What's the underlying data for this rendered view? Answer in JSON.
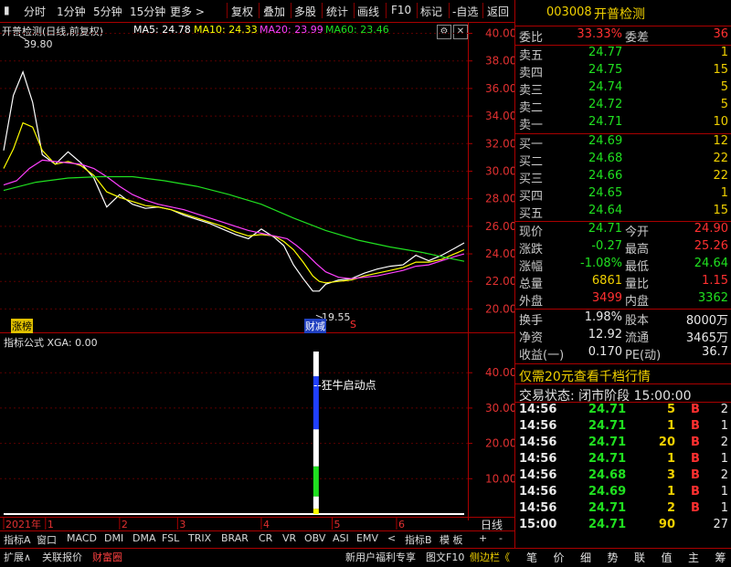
{
  "toolbar": {
    "left_tabs": [
      "分时",
      "1分钟",
      "5分钟",
      "15分钟",
      "更多 >"
    ],
    "right_tabs": [
      "复权",
      "叠加",
      "多股",
      "统计",
      "画线",
      "F10",
      "标记",
      "-自选",
      "返回"
    ]
  },
  "chart_header": {
    "title": "开普检测(日线,前复权)",
    "ma5": "MA5: 24.78",
    "ma10": "MA10: 24.33",
    "ma20": "MA20: 23.99",
    "ma60": "MA60: 23.46",
    "high_mark": "39.80",
    "low_mark": "19.55",
    "tag_left": "涨榜",
    "tag_mid": "财减",
    "tag_s": "S",
    "colors": {
      "ma5": "#ffffff",
      "ma10": "#ffff00",
      "ma20": "#ff40ff",
      "ma60": "#20e020"
    }
  },
  "indicator": {
    "title": "指标公式 XGA: 0.00",
    "annotation": "--狂牛启动点",
    "y_ticks": [
      "40.00",
      "30.00",
      "20.00",
      "10.00"
    ]
  },
  "chart_data": [
    {
      "type": "line",
      "title": "开普检测(日线,前复权)",
      "y_ticks": [
        "40.00",
        "38.00",
        "36.00",
        "34.00",
        "32.00",
        "30.00",
        "28.00",
        "26.00",
        "24.00",
        "22.00",
        "20.00"
      ],
      "ylim": [
        19.3,
        40.3
      ],
      "x_ticks": [
        "2021年",
        "1",
        "2",
        "3",
        "4",
        "5",
        "6"
      ],
      "x_tick_days": [
        0,
        13,
        36,
        54,
        80,
        102,
        122
      ],
      "days": 143,
      "series": [
        {
          "name": "MA5",
          "values": [
            [
              0,
              31.5
            ],
            [
              3,
              35.5
            ],
            [
              6,
              37.2
            ],
            [
              9,
              35
            ],
            [
              12,
              31.2
            ],
            [
              16,
              30.5
            ],
            [
              20,
              31.4
            ],
            [
              24,
              30.6
            ],
            [
              28,
              29.5
            ],
            [
              32,
              27.4
            ],
            [
              36,
              28.3
            ],
            [
              40,
              27.6
            ],
            [
              44,
              27.3
            ],
            [
              48,
              27.4
            ],
            [
              52,
              27.2
            ],
            [
              56,
              26.8
            ],
            [
              60,
              26.5
            ],
            [
              64,
              26.2
            ],
            [
              68,
              25.8
            ],
            [
              72,
              25.4
            ],
            [
              76,
              25.1
            ],
            [
              80,
              25.8
            ],
            [
              84,
              25.2
            ],
            [
              87,
              24.6
            ],
            [
              90,
              23.2
            ],
            [
              93,
              22.2
            ],
            [
              96,
              21.3
            ],
            [
              98,
              21.3
            ],
            [
              100,
              21.8
            ],
            [
              104,
              22.1
            ],
            [
              108,
              22.2
            ],
            [
              112,
              22.6
            ],
            [
              116,
              22.9
            ],
            [
              120,
              23.1
            ],
            [
              124,
              23.2
            ],
            [
              128,
              23.9
            ],
            [
              132,
              23.5
            ],
            [
              136,
              23.9
            ],
            [
              140,
              24.4
            ],
            [
              143,
              24.8
            ]
          ]
        },
        {
          "name": "MA10",
          "values": [
            [
              0,
              30.2
            ],
            [
              3,
              31.6
            ],
            [
              6,
              33.5
            ],
            [
              9,
              33.2
            ],
            [
              12,
              31.5
            ],
            [
              16,
              30.5
            ],
            [
              20,
              30.7
            ],
            [
              24,
              30.4
            ],
            [
              28,
              29.7
            ],
            [
              32,
              28.5
            ],
            [
              36,
              28.1
            ],
            [
              40,
              27.8
            ],
            [
              44,
              27.5
            ],
            [
              48,
              27.4
            ],
            [
              52,
              27.2
            ],
            [
              56,
              26.9
            ],
            [
              60,
              26.6
            ],
            [
              64,
              26.3
            ],
            [
              68,
              26
            ],
            [
              72,
              25.6
            ],
            [
              76,
              25.3
            ],
            [
              80,
              25.4
            ],
            [
              84,
              25.3
            ],
            [
              87,
              24.9
            ],
            [
              90,
              24.3
            ],
            [
              93,
              23.4
            ],
            [
              96,
              22.4
            ],
            [
              98,
              22
            ],
            [
              100,
              21.9
            ],
            [
              104,
              22
            ],
            [
              108,
              22.1
            ],
            [
              112,
              22.4
            ],
            [
              116,
              22.6
            ],
            [
              120,
              22.8
            ],
            [
              124,
              23
            ],
            [
              128,
              23.4
            ],
            [
              132,
              23.4
            ],
            [
              136,
              23.6
            ],
            [
              140,
              24
            ],
            [
              143,
              24.3
            ]
          ]
        },
        {
          "name": "MA20",
          "values": [
            [
              0,
              29
            ],
            [
              4,
              29.3
            ],
            [
              8,
              30.2
            ],
            [
              12,
              30.8
            ],
            [
              16,
              30.7
            ],
            [
              20,
              30.6
            ],
            [
              24,
              30.5
            ],
            [
              28,
              30.2
            ],
            [
              32,
              29.6
            ],
            [
              36,
              28.9
            ],
            [
              40,
              28.3
            ],
            [
              44,
              27.9
            ],
            [
              48,
              27.6
            ],
            [
              52,
              27.4
            ],
            [
              56,
              27.2
            ],
            [
              60,
              26.9
            ],
            [
              64,
              26.6
            ],
            [
              68,
              26.3
            ],
            [
              72,
              26
            ],
            [
              76,
              25.7
            ],
            [
              80,
              25.5
            ],
            [
              84,
              25.3
            ],
            [
              88,
              25.1
            ],
            [
              91,
              24.6
            ],
            [
              94,
              24
            ],
            [
              97,
              23.3
            ],
            [
              100,
              22.7
            ],
            [
              104,
              22.3
            ],
            [
              108,
              22.2
            ],
            [
              112,
              22.3
            ],
            [
              116,
              22.4
            ],
            [
              120,
              22.6
            ],
            [
              124,
              22.8
            ],
            [
              128,
              23.1
            ],
            [
              132,
              23.2
            ],
            [
              136,
              23.5
            ],
            [
              140,
              23.8
            ],
            [
              143,
              24
            ]
          ]
        },
        {
          "name": "MA60",
          "values": [
            [
              0,
              28.6
            ],
            [
              10,
              29.2
            ],
            [
              20,
              29.5
            ],
            [
              30,
              29.6
            ],
            [
              40,
              29.6
            ],
            [
              50,
              29.3
            ],
            [
              60,
              28.9
            ],
            [
              70,
              28.3
            ],
            [
              80,
              27.6
            ],
            [
              90,
              26.6
            ],
            [
              100,
              25.7
            ],
            [
              110,
              25
            ],
            [
              120,
              24.5
            ],
            [
              130,
              24.1
            ],
            [
              136,
              23.8
            ],
            [
              143,
              23.46
            ]
          ]
        }
      ]
    },
    {
      "type": "bar",
      "title": "指标公式 XGA: 0.00",
      "y_ticks": [
        "40.00",
        "30.00",
        "20.00",
        "10.00"
      ],
      "ylim": [
        0,
        46
      ],
      "days": 143,
      "bar_day": 97,
      "segments": [
        {
          "from": 0,
          "to": 1.5,
          "color": "#ffff00"
        },
        {
          "from": 1.5,
          "to": 5,
          "color": "#ffffff"
        },
        {
          "from": 5,
          "to": 13.5,
          "color": "#20e020"
        },
        {
          "from": 13.5,
          "to": 24,
          "color": "#ffffff"
        },
        {
          "from": 24,
          "to": 39,
          "color": "#2040ff"
        },
        {
          "from": 39,
          "to": 46,
          "color": "#ffffff"
        }
      ]
    }
  ],
  "bottom_tabs_row1": [
    "指标A",
    "窗口",
    "MACD",
    "DMI",
    "DMA",
    "FSL",
    "TRIX",
    "BRAR",
    "CR",
    "VR",
    "OBV",
    "ASI",
    "EMV",
    "<",
    "指标B",
    "模 板",
    "+",
    "-",
    "日线"
  ],
  "bottom_tabs_row2": [
    "扩展∧",
    "关联报价",
    "财富圈"
  ],
  "bottom_right_links": [
    "新用户福利专享",
    "图文F10",
    "侧边栏《"
  ],
  "right_panel": {
    "code": "003008",
    "name": "开普检测",
    "weibi_label": "委比",
    "weibi": "33.33%",
    "weicha_label": "委差",
    "weicha": "36",
    "asks": [
      {
        "label": "卖五",
        "price": "24.77",
        "vol": "1"
      },
      {
        "label": "卖四",
        "price": "24.75",
        "vol": "15"
      },
      {
        "label": "卖三",
        "price": "24.74",
        "vol": "5"
      },
      {
        "label": "卖二",
        "price": "24.72",
        "vol": "5"
      },
      {
        "label": "卖一",
        "price": "24.71",
        "vol": "10"
      }
    ],
    "bids": [
      {
        "label": "买一",
        "price": "24.69",
        "vol": "12"
      },
      {
        "label": "买二",
        "price": "24.68",
        "vol": "22"
      },
      {
        "label": "买三",
        "price": "24.66",
        "vol": "22"
      },
      {
        "label": "买四",
        "price": "24.65",
        "vol": "1"
      },
      {
        "label": "买五",
        "price": "24.64",
        "vol": "15"
      }
    ],
    "quote": [
      {
        "l1": "现价",
        "v1": "24.71",
        "c1": "green",
        "l2": "今开",
        "v2": "24.90",
        "c2": "red"
      },
      {
        "l1": "涨跌",
        "v1": "-0.27",
        "c1": "green",
        "l2": "最高",
        "v2": "25.26",
        "c2": "red"
      },
      {
        "l1": "涨幅",
        "v1": "-1.08%",
        "c1": "green",
        "l2": "最低",
        "v2": "24.64",
        "c2": "green"
      },
      {
        "l1": "总量",
        "v1": "6861",
        "c1": "yellow",
        "l2": "量比",
        "v2": "1.15",
        "c2": "red"
      },
      {
        "l1": "外盘",
        "v1": "3499",
        "c1": "red",
        "l2": "内盘",
        "v2": "3362",
        "c2": "green"
      }
    ],
    "stats": [
      {
        "l1": "换手",
        "v1": "1.98%",
        "l2": "股本",
        "v2": "8000万"
      },
      {
        "l1": "净资",
        "v1": "12.92",
        "l2": "流通",
        "v2": "3465万"
      },
      {
        "l1": "收益(一)",
        "v1": "0.170",
        "l2": "PE(动)",
        "v2": "36.7"
      }
    ],
    "promo": "仅需20元查看千档行情",
    "trade_status_label": "交易状态:",
    "trade_status": "闭市阶段",
    "trade_time": "15:00:00",
    "ticks": [
      {
        "t": "14:56",
        "p": "24.71",
        "v": "5",
        "s": "B",
        "n": "2"
      },
      {
        "t": "14:56",
        "p": "24.71",
        "v": "1",
        "s": "B",
        "n": "1"
      },
      {
        "t": "14:56",
        "p": "24.71",
        "v": "20",
        "s": "B",
        "n": "2"
      },
      {
        "t": "14:56",
        "p": "24.71",
        "v": "1",
        "s": "B",
        "n": "1"
      },
      {
        "t": "14:56",
        "p": "24.68",
        "v": "3",
        "s": "B",
        "n": "2"
      },
      {
        "t": "14:56",
        "p": "24.69",
        "v": "1",
        "s": "B",
        "n": "1"
      },
      {
        "t": "14:56",
        "p": "24.71",
        "v": "2",
        "s": "B",
        "n": "1"
      },
      {
        "t": "15:00",
        "p": "24.71",
        "v": "90",
        "s": "",
        "n": "27"
      }
    ],
    "bottom_tabs": [
      "笔",
      "价",
      "细",
      "势",
      "联",
      "值",
      "主",
      "筹"
    ]
  }
}
